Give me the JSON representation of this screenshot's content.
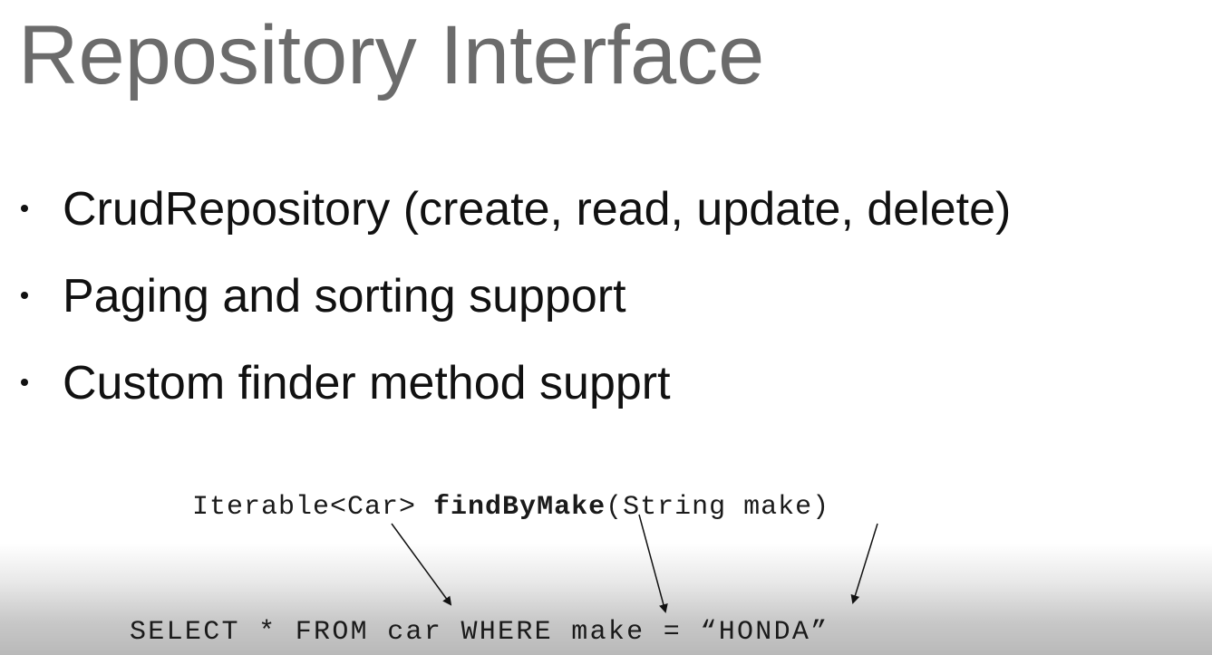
{
  "slide": {
    "title": "Repository Interface",
    "bullets": [
      {
        "text": "CrudRepository (create, read, update, delete)"
      },
      {
        "text": "Paging and sorting support"
      },
      {
        "text": "Custom finder method supprt"
      }
    ],
    "signature": {
      "return_type": "Iterable<Car> ",
      "method_name": "findByMake",
      "params": "(String make)"
    },
    "sql": "SELECT * FROM car WHERE make = “HONDA”"
  }
}
